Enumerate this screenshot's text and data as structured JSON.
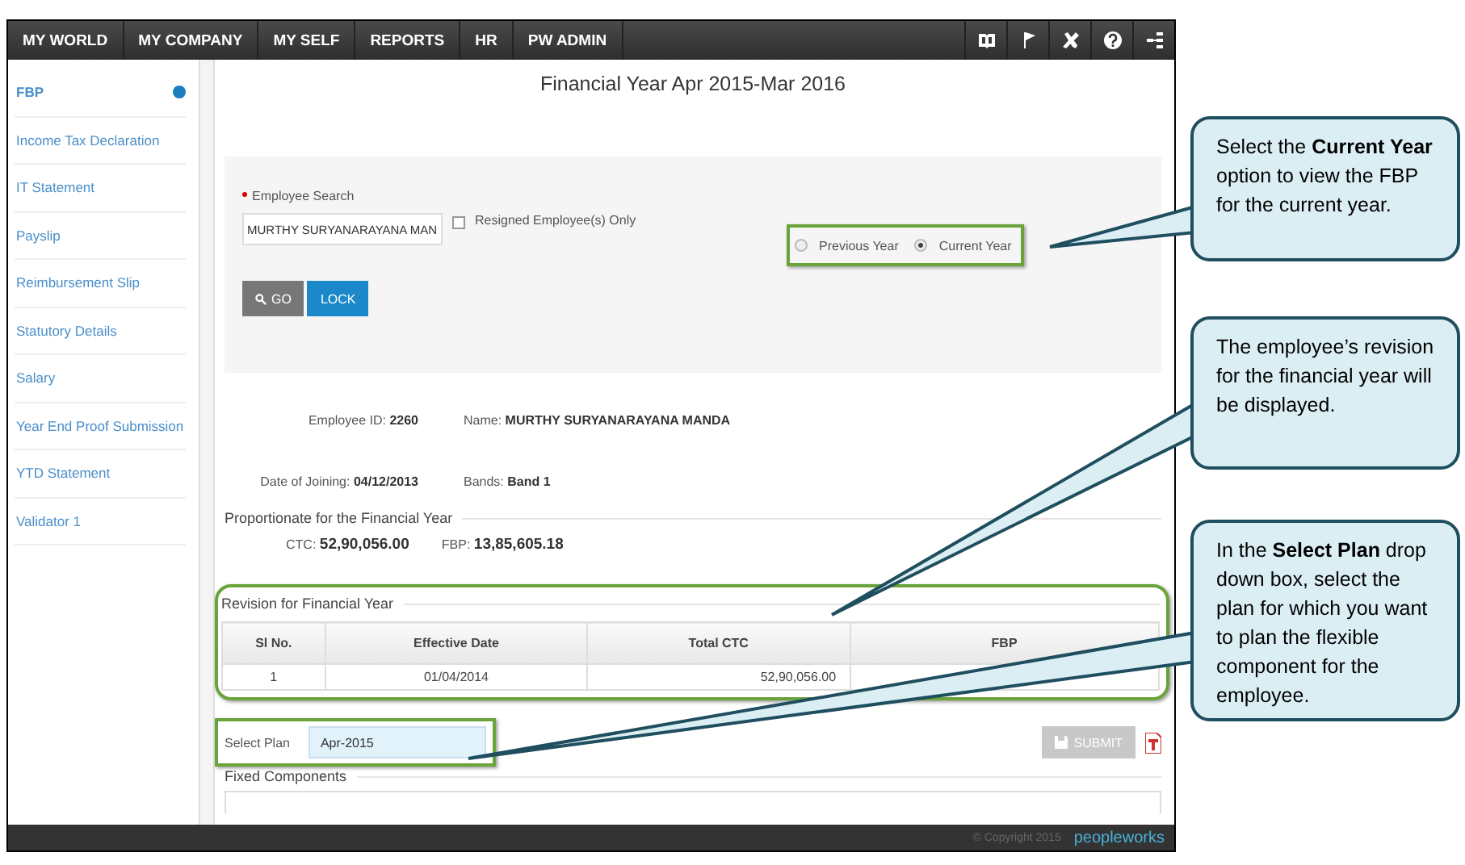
{
  "nav": {
    "items": [
      {
        "label": "MY WORLD"
      },
      {
        "label": "MY COMPANY"
      },
      {
        "label": "MY SELF"
      },
      {
        "label": "REPORTS"
      },
      {
        "label": "HR"
      },
      {
        "label": "PW ADMIN"
      }
    ]
  },
  "sidebar": {
    "items": [
      {
        "label": "FBP",
        "selected": true
      },
      {
        "label": "Income Tax Declaration",
        "selected": false
      },
      {
        "label": "IT Statement",
        "selected": false
      },
      {
        "label": "Payslip",
        "selected": false
      },
      {
        "label": "Reimbursement Slip",
        "selected": false
      },
      {
        "label": "Statutory Details",
        "selected": false
      },
      {
        "label": "Salary",
        "selected": false
      },
      {
        "label": "Year End Proof Submission",
        "selected": false
      },
      {
        "label": "YTD Statement",
        "selected": false
      },
      {
        "label": "Validator 1",
        "selected": false
      }
    ]
  },
  "page_title": "Financial Year Apr 2015-Mar 2016",
  "employee_search": {
    "label": "Employee Search",
    "value": "MURTHY SURYANARAYANA MAN",
    "resigned_only": {
      "label": "Resigned Employee(s) Only",
      "checked": false
    }
  },
  "year_options": [
    {
      "label": "Previous Year",
      "selected": false
    },
    {
      "label": "Current Year",
      "selected": true
    }
  ],
  "buttons": {
    "go": "GO",
    "lock": "LOCK"
  },
  "employee": {
    "fields": [
      {
        "label": "Employee ID:",
        "value": "2260"
      },
      {
        "label": "Name:",
        "value": "MURTHY SURYANARAYANA MANDA"
      },
      {
        "label": "Date of Joining:",
        "value": "04/12/2013"
      },
      {
        "label": "Bands:",
        "value": "Band 1"
      }
    ]
  },
  "proportionate": {
    "title": "Proportionate for the Financial Year",
    "fields": [
      {
        "label": "CTC:",
        "value": "52,90,056.00"
      },
      {
        "label": "FBP:",
        "value": "13,85,605.18"
      }
    ]
  },
  "revision": {
    "title": "Revision for Financial Year",
    "columns": [
      "Sl No.",
      "Effective Date",
      "Total CTC",
      "FBP"
    ],
    "rows": [
      {
        "sl_no": "1",
        "effective_date": "01/04/2014",
        "total_ctc": "52,90,056.00"
      }
    ]
  },
  "select_plan": {
    "label": "Select Plan",
    "value": "Apr-2015"
  },
  "submit": {
    "label": "SUBMIT",
    "disabled": true
  },
  "fixed_components": {
    "title": "Fixed Components"
  },
  "footer": {
    "copyright": "© Copyright 2015",
    "brand": "peopleworks"
  },
  "callouts": [
    {
      "text": "Select the **Current Year** option to view the FBP for the current year."
    },
    {
      "text": "The employee’s revision for the financial year will be displayed."
    },
    {
      "text": "In the **Select Plan** drop down box, select the plan for which you want to plan the flexible component for the employee."
    }
  ]
}
